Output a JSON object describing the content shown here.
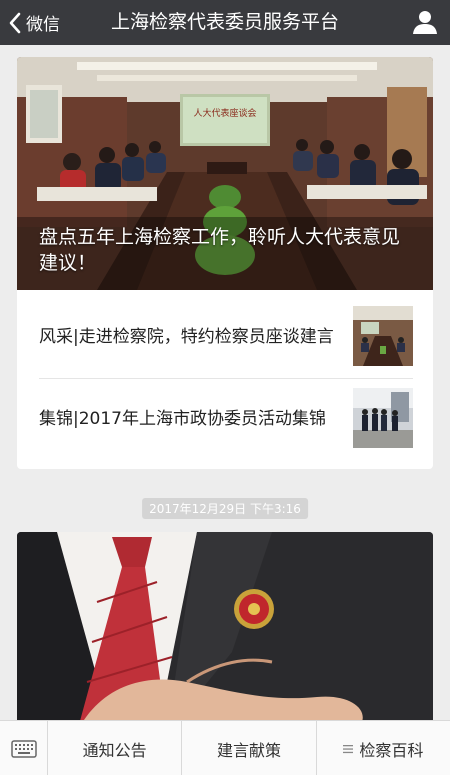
{
  "nav": {
    "back_label": "微信",
    "title": "上海检察代表委员服务平台",
    "back_icon": "chevron-left-icon",
    "profile_icon": "person-icon"
  },
  "card1": {
    "hero_title": "盘点五年上海检察工作，聆听人大代表意见建议！",
    "hero_banner_text": "人大代表座谈会",
    "items": [
      {
        "title": "风采|走进检察院，特约检察员座谈建言"
      },
      {
        "title": "集锦|2017年上海市政协委员活动集锦"
      }
    ]
  },
  "timestamp": "2017年12月29日 下午3:16",
  "menu": {
    "keyboard_icon": "keyboard-icon",
    "items": [
      {
        "label": "通知公告"
      },
      {
        "label": "建言献策"
      },
      {
        "label": "检察百科",
        "icon": "menu-lines-icon"
      }
    ]
  },
  "colors": {
    "navbar": "#393a3e",
    "background": "#ededed",
    "timestamp_bg": "#d4d4d4"
  }
}
